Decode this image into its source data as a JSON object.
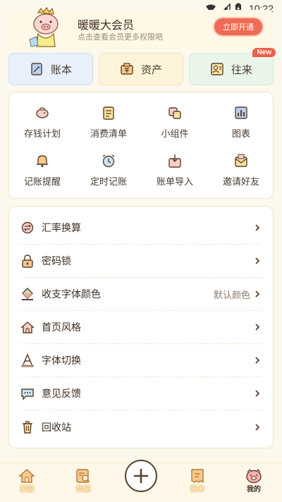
{
  "status_bar": {
    "time": "10:22"
  },
  "member": {
    "title": "暖暖大会员",
    "subtitle": "点击查看会员更多权限吧",
    "button": "立即开通"
  },
  "tiles": [
    {
      "label": "账本",
      "icon": "ledger-icon"
    },
    {
      "label": "资产",
      "icon": "assets-icon"
    },
    {
      "label": "往来",
      "icon": "contacts-icon",
      "badge": "New"
    }
  ],
  "grid": [
    {
      "label": "存钱计划",
      "icon": "piggy-bank-icon"
    },
    {
      "label": "消费清单",
      "icon": "checklist-icon"
    },
    {
      "label": "小组件",
      "icon": "widget-icon"
    },
    {
      "label": "图表",
      "icon": "chart-icon"
    },
    {
      "label": "记账提醒",
      "icon": "bell-icon"
    },
    {
      "label": "定时记账",
      "icon": "alarm-clock-icon"
    },
    {
      "label": "账单导入",
      "icon": "import-icon"
    },
    {
      "label": "邀请好友",
      "icon": "invite-icon"
    }
  ],
  "settings": [
    {
      "label": "汇率换算",
      "icon": "exchange-icon",
      "value": ""
    },
    {
      "label": "密码锁",
      "icon": "lock-icon",
      "value": ""
    },
    {
      "label": "收支字体颜色",
      "icon": "paint-bucket-icon",
      "value": "默认颜色"
    },
    {
      "label": "首页风格",
      "icon": "home-style-icon",
      "value": ""
    },
    {
      "label": "字体切换",
      "icon": "font-icon",
      "value": ""
    },
    {
      "label": "意见反馈",
      "icon": "feedback-icon",
      "value": ""
    },
    {
      "label": "回收站",
      "icon": "trash-icon",
      "value": ""
    }
  ],
  "nav": [
    {
      "label": "家园",
      "icon": "home-icon",
      "active": false
    },
    {
      "label": "明细",
      "icon": "details-icon",
      "active": false
    },
    {
      "label": "账单",
      "icon": "bill-icon",
      "active": false
    },
    {
      "label": "我的",
      "icon": "pig-profile-icon",
      "active": true
    }
  ],
  "colors": {
    "accent": "#f06b55",
    "background": "#fdf8ec",
    "icon_stroke": "#5a4030",
    "icon_fill": "#f7c98a"
  }
}
